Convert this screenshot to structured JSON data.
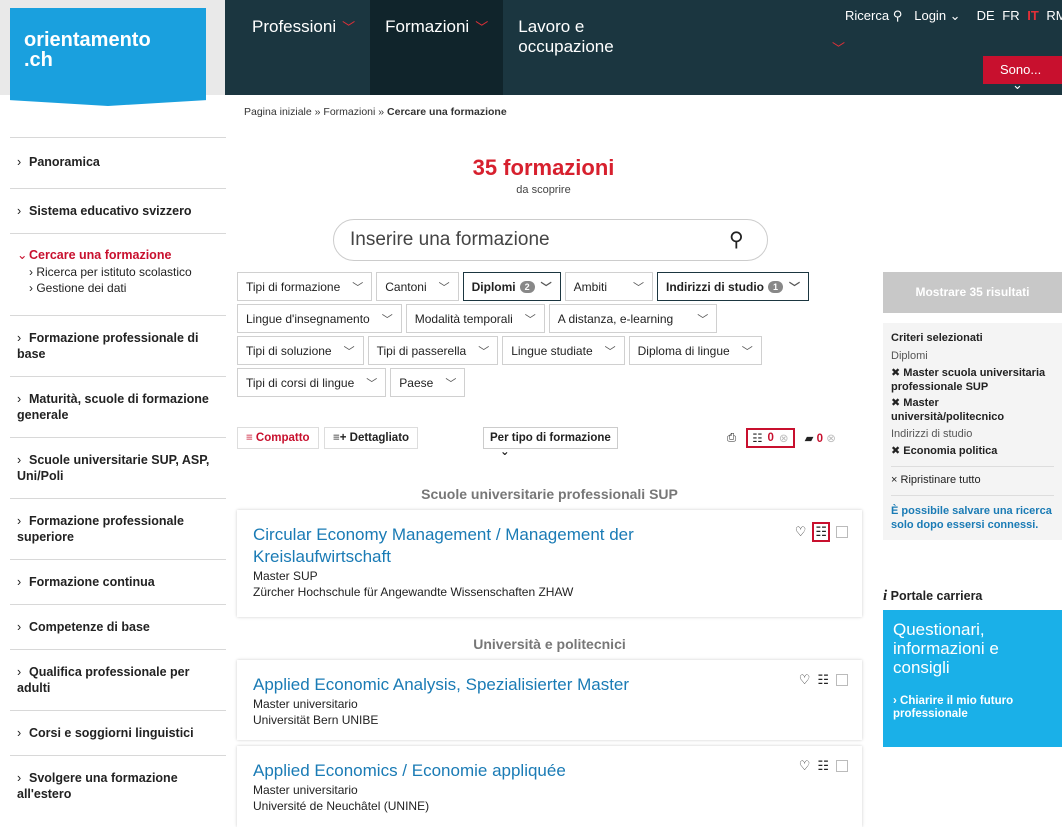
{
  "header": {
    "logo_line1": "orientamento",
    "logo_line2": ".ch",
    "nav": [
      {
        "label": "Professioni",
        "active": false
      },
      {
        "label": "Formazioni",
        "active": true
      },
      {
        "label": "Lavoro e occupazione",
        "active": false
      }
    ],
    "search_label": "Ricerca",
    "login_label": "Login",
    "languages": [
      "DE",
      "FR",
      "IT",
      "RM"
    ],
    "sono_label": "Sono..."
  },
  "breadcrumb": {
    "home": "Pagina iniziale",
    "sep": "»",
    "section": "Formazioni",
    "current": "Cercare una formazione"
  },
  "sidebar": {
    "items": [
      {
        "label": "Panoramica"
      },
      {
        "label": "Sistema educativo svizzero"
      },
      {
        "label": "Cercare una formazione",
        "active": true,
        "sub": [
          "Ricerca per istituto scolastico",
          "Gestione dei dati"
        ]
      },
      {
        "label": "Formazione professionale di base"
      },
      {
        "label": "Maturità, scuole di formazione generale"
      },
      {
        "label": "Scuole universitarie SUP, ASP, Uni/Poli"
      },
      {
        "label": "Formazione professionale superiore"
      },
      {
        "label": "Formazione continua"
      },
      {
        "label": "Competenze di base"
      },
      {
        "label": "Qualifica professionale per adulti"
      },
      {
        "label": "Corsi e soggiorni linguistici"
      },
      {
        "label": "Svolgere una formazione all'estero"
      }
    ]
  },
  "results": {
    "count": "35 formazioni",
    "subtitle": "da scoprire"
  },
  "search": {
    "placeholder": "Inserire una formazione"
  },
  "filters": {
    "tipi_formazione": "Tipi di formazione",
    "cantoni": "Cantoni",
    "diplomi": "Diplomi",
    "diplomi_badge": "2",
    "ambiti": "Ambiti",
    "indirizzi": "Indirizzi di studio",
    "indirizzi_badge": "1",
    "lingue_insegnamento": "Lingue d'insegnamento",
    "modalita": "Modalità temporali",
    "distanza": "A distanza, e-learning",
    "tipi_soluzione": "Tipi di soluzione",
    "tipi_passerella": "Tipi di passerella",
    "lingue_studiate": "Lingue studiate",
    "diploma_lingue": "Diploma di lingue",
    "tipi_corsi": "Tipi di corsi di lingue",
    "paese": "Paese"
  },
  "toolbar": {
    "compact": "Compatto",
    "detailed": "Dettagliato",
    "sort": "Per tipo di formazione",
    "compare_count": "0",
    "saved_count": "0"
  },
  "sections": [
    {
      "title": "Scuole universitarie professionali SUP"
    },
    {
      "title": "Università e politecnici"
    }
  ],
  "cards": [
    {
      "title": "Circular Economy Management / Management der Kreislaufwirtschaft",
      "type": "Master SUP",
      "school": "Zürcher Hochschule für Angewandte Wissenschaften ZHAW"
    },
    {
      "title": "Applied Economic Analysis, Spezialisierter Master",
      "type": "Master universitario",
      "school": "Universität Bern UNIBE"
    },
    {
      "title": "Applied Economics / Economie appliquée",
      "type": "Master universitario",
      "school": "Université de Neuchâtel (UNINE)"
    }
  ],
  "right": {
    "show_button": "Mostrare 35 risultati",
    "criteria_title": "Criteri selezionati",
    "group1": "Diplomi",
    "val1": "Master scuola universitaria professionale SUP",
    "val2": "Master università/politecnico",
    "group2": "Indirizzi di studio",
    "val3": "Economia politica",
    "reset": "Ripristinare tutto",
    "note": "È possibile salvare una ricerca solo dopo essersi connessi.",
    "portale": "Portale carriera",
    "box_title": "Questionari, informazioni e consigli",
    "box_link": "Chiarire il mio futuro professionale"
  }
}
